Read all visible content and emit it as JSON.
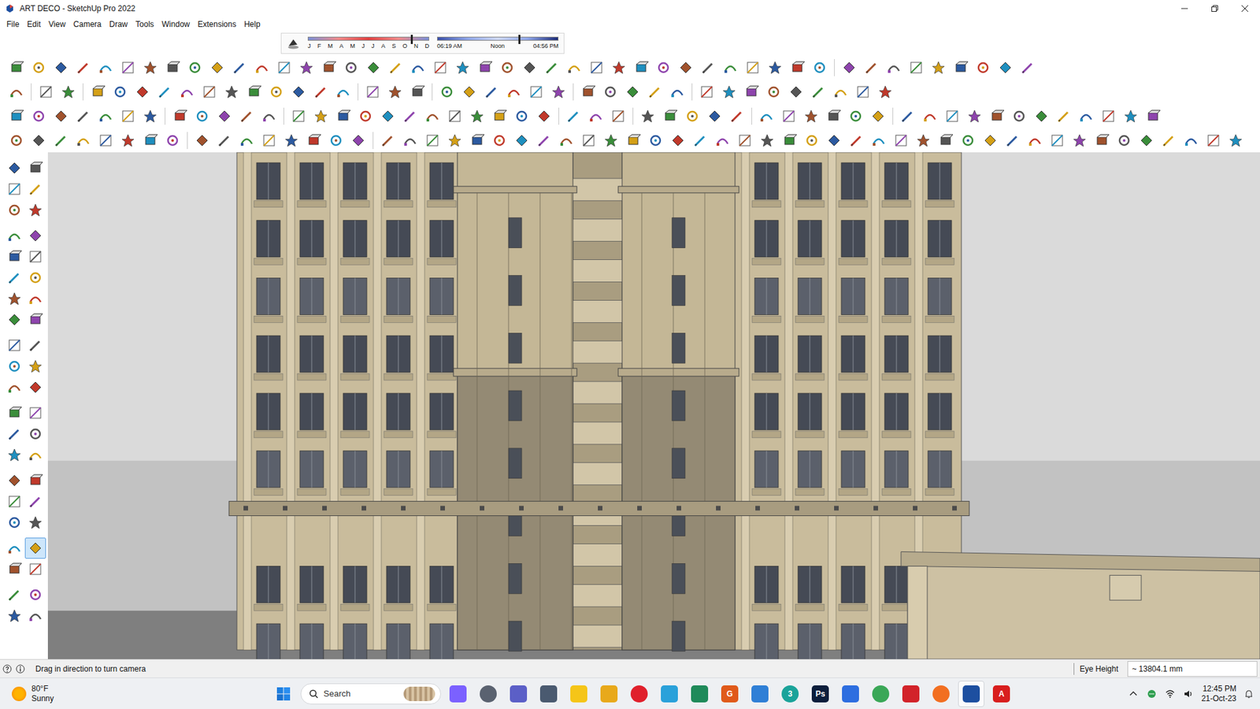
{
  "window": {
    "title": "ART DECO - SketchUp Pro 2022"
  },
  "menu": {
    "items": [
      "File",
      "Edit",
      "View",
      "Camera",
      "Draw",
      "Tools",
      "Window",
      "Extensions",
      "Help"
    ]
  },
  "shadows": {
    "months": [
      "J",
      "F",
      "M",
      "A",
      "M",
      "J",
      "J",
      "A",
      "S",
      "O",
      "N",
      "D"
    ],
    "month_level": 0.85,
    "times": [
      "06:19 AM",
      "Noon",
      "04:56 PM"
    ],
    "time_level": 0.67
  },
  "left_toolbar": {
    "tools": [
      {
        "selected": false
      },
      {
        "selected": false
      },
      {
        "selected": false
      },
      {
        "selected": false
      },
      {
        "selected": false
      },
      {
        "selected": false
      },
      {
        "selected": false
      },
      {
        "selected": false
      },
      {
        "selected": false
      },
      {
        "selected": false
      },
      {
        "selected": false
      },
      {
        "selected": false
      },
      {
        "selected": false
      },
      {
        "selected": false
      },
      {
        "selected": false
      },
      {
        "selected": false
      },
      {
        "selected": false
      },
      {
        "selected": false
      },
      {
        "selected": false
      },
      {
        "selected": false
      },
      {
        "selected": false
      },
      {
        "selected": false
      },
      {
        "selected": false
      },
      {
        "selected": false
      },
      {
        "selected": false
      },
      {
        "selected": false
      },
      {
        "selected": false
      },
      {
        "selected": false
      },
      {
        "selected": false
      },
      {
        "selected": false
      },
      {
        "selected": false
      },
      {
        "selected": false
      },
      {
        "selected": false
      },
      {
        "selected": false
      },
      {
        "selected": false
      },
      {
        "selected": true
      },
      {
        "selected": false
      },
      {
        "selected": false
      },
      {
        "selected": false
      },
      {
        "selected": false
      },
      {
        "selected": false
      },
      {
        "selected": false
      }
    ]
  },
  "status_bar": {
    "hint": "Drag in direction to turn camera",
    "measure_label": "Eye Height",
    "measure_value": "~ 13804.1 mm"
  },
  "taskbar": {
    "weather": {
      "temperature": "80°F",
      "condition": "Sunny"
    },
    "search": {
      "label": "Search"
    },
    "apps": [
      {
        "color": "#7b61ff",
        "selected": false
      },
      {
        "color": "#5a6270",
        "selected": false
      },
      {
        "color": "#5b5fc7",
        "selected": false
      },
      {
        "color": "#4a5a70",
        "selected": false
      },
      {
        "color": "#f5c518",
        "selected": false
      },
      {
        "color": "#e8a91b",
        "selected": false
      },
      {
        "color": "#e0202c",
        "selected": false
      },
      {
        "color": "#2aa1da",
        "selected": false
      },
      {
        "color": "#1f8a5a",
        "selected": false
      },
      {
        "color": "#e05a1a",
        "selected": false,
        "glyph": "G"
      },
      {
        "color": "#2f7fd6",
        "selected": false
      },
      {
        "color": "#1aa39a",
        "selected": false,
        "glyph": "3"
      },
      {
        "color": "#0c1e3c",
        "selected": false,
        "glyph": "Ps"
      },
      {
        "color": "#2d6ee0",
        "selected": false
      },
      {
        "color": "#3aa757",
        "selected": false
      },
      {
        "color": "#d2232a",
        "selected": false
      },
      {
        "color": "#f26f21",
        "selected": false
      },
      {
        "color": "#1d4fa0",
        "selected": true
      },
      {
        "color": "#d81e1e",
        "selected": false,
        "glyph": "A"
      }
    ],
    "clock": {
      "time": "12:45 PM",
      "date": "21-Oct-23"
    }
  }
}
